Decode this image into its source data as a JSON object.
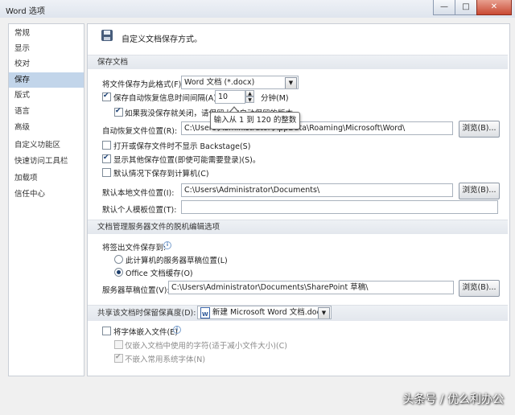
{
  "window": {
    "title": "Word 选项",
    "minimize": "—",
    "maximize": "□",
    "close": "✕"
  },
  "sidebar": {
    "items": [
      "常规",
      "显示",
      "校对",
      "保存",
      "版式",
      "语言",
      "高级",
      "自定义功能区",
      "快速访问工具栏",
      "加载项",
      "信任中心"
    ],
    "selected": "保存"
  },
  "header": {
    "icon": "floppy-disk-icon",
    "text": "自定义文档保存方式。"
  },
  "save_docs": {
    "section_title": "保存文档",
    "format_label": "将文件保存为此格式(F):",
    "format_value": "Word 文档 (*.docx)",
    "autorecover_label": "保存自动恢复信息时间间隔(A)",
    "autorecover_checked": true,
    "autorecover_minutes": "10",
    "minutes_unit": "分钟(M)",
    "keep_last_label": "如果我没保存就关闭，请保留上次自动保留的版本",
    "keep_last_checked": true,
    "autorecover_location_label": "自动恢复文件位置(R):",
    "autorecover_location_value": "C:\\Users\\Administrator\\AppData\\Roaming\\Microsoft\\Word\\",
    "browse": "浏览(B)...",
    "no_backstage_label": "打开或保存文件时不显示 Backstage(S)",
    "no_backstage_checked": false,
    "show_other_label": "显示其他保存位置(即使可能需要登录)(S)。",
    "show_other_checked": true,
    "default_computer_label": "默认情况下保存到计算机(C)",
    "default_computer_checked": false,
    "local_location_label": "默认本地文件位置(I):",
    "local_location_value": "C:\\Users\\Administrator\\Documents\\",
    "template_location_label": "默认个人模板位置(T):",
    "template_location_value": ""
  },
  "tooltip": {
    "text": "输入从 1 到 120 的整数"
  },
  "offline": {
    "section_title": "文档管理服务器文件的脱机编辑选项",
    "save_to_label": "将签出文件保存到:",
    "server_drafts_label": "此计算机的服务器草稿位置(L)",
    "server_drafts_checked": false,
    "office_cache_label": "Office 文档缓存(O)",
    "office_cache_checked": true,
    "drafts_location_label": "服务器草稿位置(V):",
    "drafts_location_value": "C:\\Users\\Administrator\\Documents\\SharePoint 草稿\\"
  },
  "fidelity": {
    "section_title": "共享该文档时保留保真度(D):",
    "doc_value": "新建 Microsoft Word 文档.docx",
    "embed_fonts_label": "将字体嵌入文件(E)",
    "embed_fonts_checked": false,
    "embed_used_chars_label": "仅嵌入文档中使用的字符(适于减小文件大小)(C)",
    "embed_used_chars_checked": false,
    "no_common_fonts_label": "不嵌入常用系统字体(N)",
    "no_common_fonts_checked": true
  },
  "watermark": "头条号 / 优么利办公"
}
